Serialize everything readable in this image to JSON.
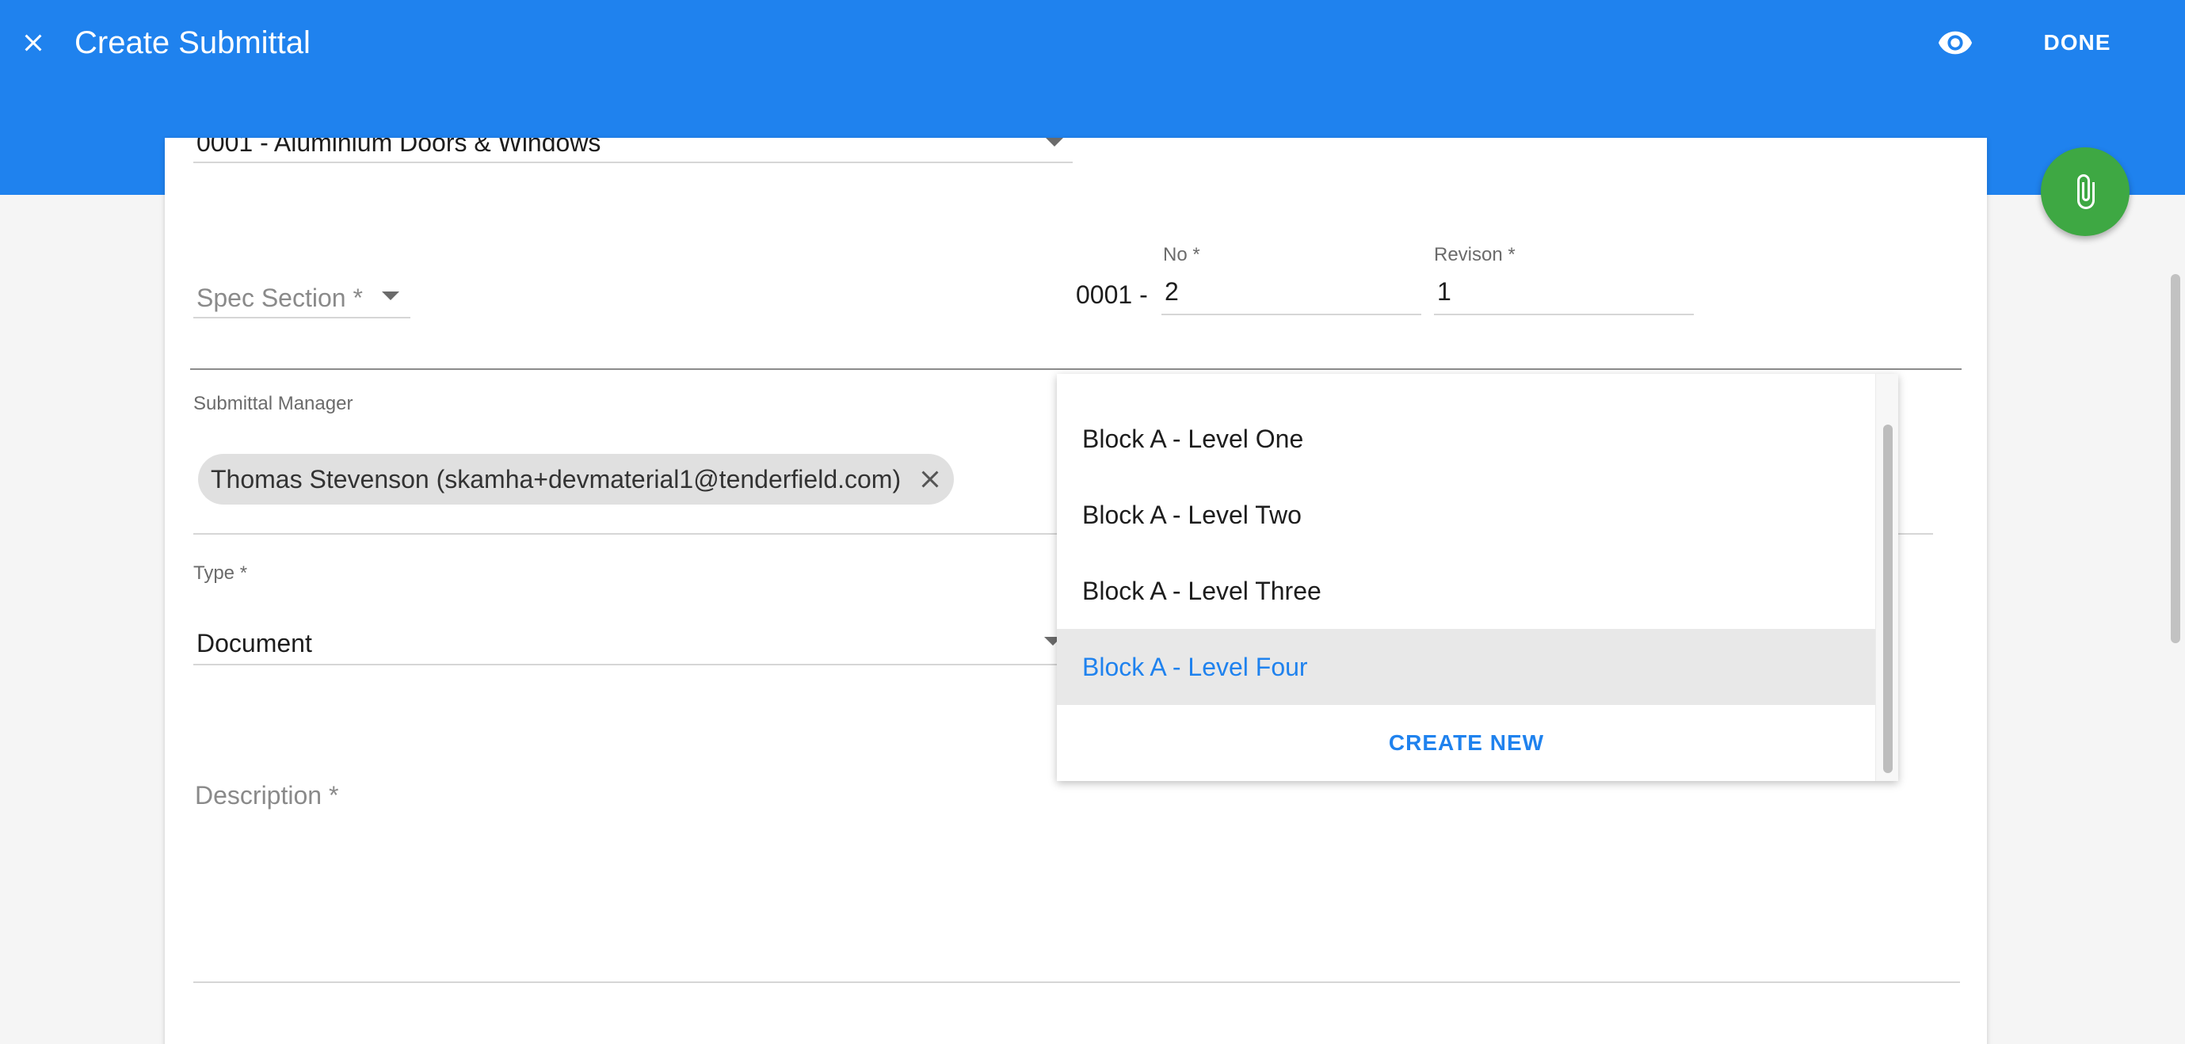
{
  "appbar": {
    "title": "Create Submittal",
    "done_label": "DONE",
    "close_icon": "close-icon",
    "preview_icon": "eye-icon",
    "color": "#1f82ee"
  },
  "form": {
    "package": {
      "value": "0001 - Aluminium Doors & Windows"
    },
    "spec_section": {
      "placeholder": "Spec Section *"
    },
    "number": {
      "prefix": "0001 -",
      "label": "No *",
      "value": "2"
    },
    "revision": {
      "label": "Revison *",
      "value": "1"
    },
    "manager": {
      "label": "Submittal Manager",
      "chip": "Thomas Stevenson (skamha+devmaterial1@tenderfield.com)"
    },
    "type": {
      "label": "Type *",
      "value": "Document"
    },
    "description": {
      "placeholder": "Description *"
    }
  },
  "dropdown": {
    "items": [
      {
        "label": "Block A - Level One",
        "selected": false
      },
      {
        "label": "Block A - Level Two",
        "selected": false
      },
      {
        "label": "Block A - Level Three",
        "selected": false
      },
      {
        "label": "Block A - Level Four",
        "selected": true
      }
    ],
    "create_label": "CREATE NEW"
  },
  "fab": {
    "icon": "paperclip-icon",
    "color": "#3ea843"
  }
}
